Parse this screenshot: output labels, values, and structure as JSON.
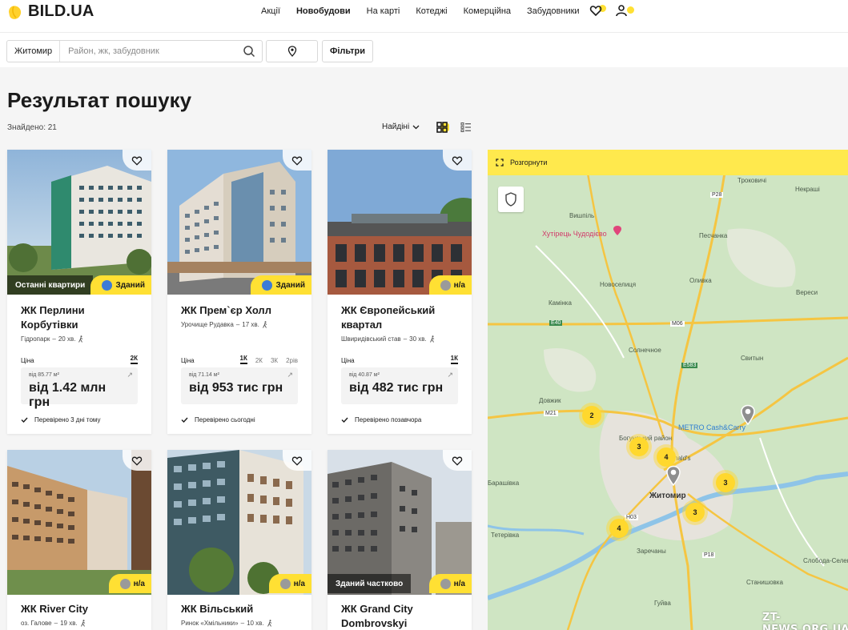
{
  "brand": {
    "logo_text": "BILD.UA"
  },
  "nav": {
    "items": [
      "Акції",
      "Новобудови",
      "На карті",
      "Котеджі",
      "Комерційна",
      "Забудовники"
    ]
  },
  "search": {
    "city": "Житомир",
    "placeholder": "Район, жк, забудовник",
    "filters_label": "Фільтри"
  },
  "results": {
    "title": "Результат пошуку",
    "found": "Знайдено: 21",
    "sort": "Найдіні"
  },
  "cards": [
    {
      "name": "ЖК Перлини Корбутівки",
      "location": "Гідропарк",
      "walk": "20 хв.",
      "tag_left": "Останні квартири",
      "status": "Зданий",
      "price_label": "Ціна",
      "room_types": [
        "2К"
      ],
      "active_room": "2К",
      "area": "від 85.77 м²",
      "price": "від 1.42 млн грн",
      "verified": "Перевірено 3 дні тому"
    },
    {
      "name": "ЖК Прем`єр Холл",
      "location": "Урочище Рудавка",
      "walk": "17 хв.",
      "tag_left": "",
      "status": "Зданий",
      "price_label": "Ціна",
      "room_types": [
        "1К",
        "2К",
        "3К",
        "2рів"
      ],
      "active_room": "1К",
      "area": "від 71.14 м²",
      "price": "від 953 тис грн",
      "verified": "Перевірено сьогодні"
    },
    {
      "name": "ЖК Європейський квартал",
      "location": "Швиридівський став",
      "walk": "30 хв.",
      "tag_left": "",
      "status": "н/а",
      "price_label": "Ціна",
      "room_types": [
        "1К"
      ],
      "active_room": "1К",
      "area": "від 40.87 м²",
      "price": "від 482 тис грн",
      "verified": "Перевірено позавчора"
    },
    {
      "name": "ЖК River City",
      "location": "оз. Галове",
      "walk": "19 хв.",
      "tag_left": "",
      "status": "н/а"
    },
    {
      "name": "ЖК Вільський",
      "location": "Ринок «Хмільники»",
      "walk": "10 хв.",
      "tag_left": "",
      "status": "н/а"
    },
    {
      "name": "ЖК Grand City Dombrovskyi",
      "location": "",
      "walk": "",
      "tag_left": "Зданий частково",
      "status": "н/а"
    }
  ],
  "map": {
    "expand_label": "Розгорнути",
    "labels": [
      "Троковичі",
      "Некраші",
      "Вишпіль",
      "Хутірець Чудодієво",
      "Песчанка",
      "Новоселиця",
      "Оливка",
      "Вереси",
      "Камінка",
      "Солнечное",
      "Свитын",
      "Довжик",
      "Богунський район",
      "METRO Cash&Carry",
      "McDonald's",
      "Житомир",
      "Барашівка",
      "Тетерівка",
      "Заречаны",
      "Слобода-Селец",
      "Станишовка",
      "Гуйва"
    ],
    "road_labels": [
      "P28",
      "E40",
      "M06",
      "E583",
      "M21",
      "H03",
      "P18"
    ],
    "clusters": [
      "2",
      "3",
      "4",
      "3",
      "3",
      "4"
    ]
  },
  "watermark": "ZT-NEWS.ORG.UA",
  "colors": {
    "accent": "#ffe033",
    "map_bg": "#cbe3c0",
    "road": "#f5c542"
  }
}
